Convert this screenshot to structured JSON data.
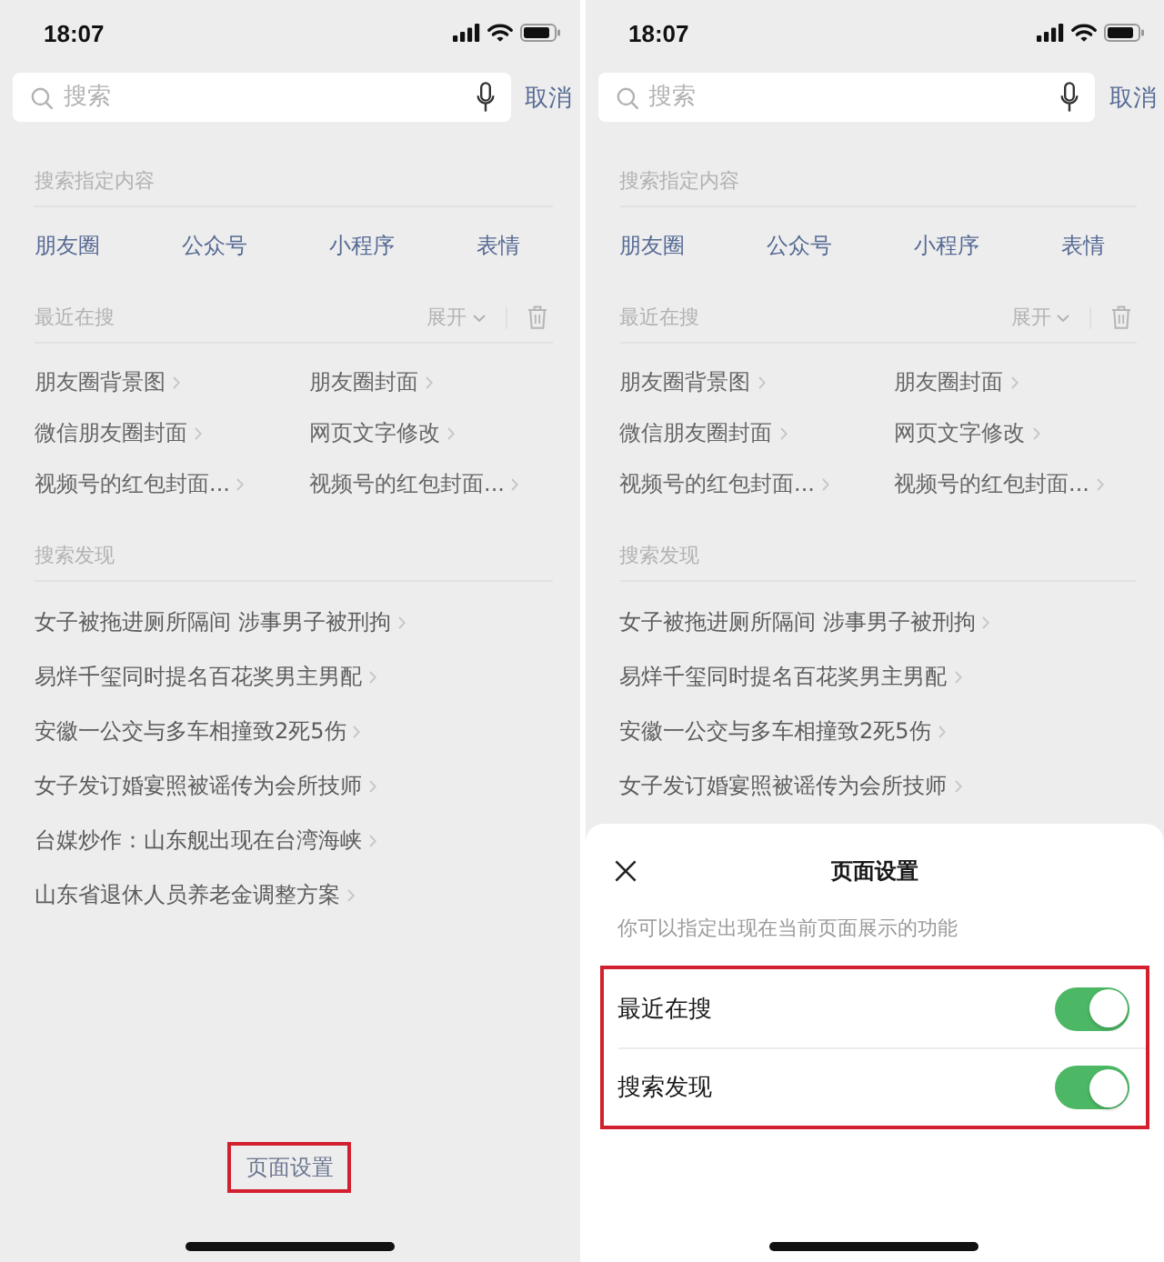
{
  "screens": [
    {
      "status_bar": {
        "time": "18:07"
      },
      "search": {
        "placeholder": "搜索",
        "cancel": "取消"
      },
      "specified_content": {
        "title": "搜索指定内容",
        "links": [
          "朋友圈",
          "公众号",
          "小程序",
          "表情"
        ]
      },
      "recent_searches": {
        "title": "最近在搜",
        "expand": "展开",
        "items": [
          "朋友圈背景图",
          "朋友圈封面",
          "微信朋友圈封面",
          "网页文字修改",
          "视频号的红包封面...",
          "视频号的红包封面..."
        ]
      },
      "discovery": {
        "title": "搜索发现",
        "items": [
          "女子被拖进厕所隔间 涉事男子被刑拘",
          "易烊千玺同时提名百花奖男主男配",
          "安徽一公交与多车相撞致2死5伤",
          "女子发订婚宴照被谣传为会所技师",
          "台媒炒作：山东舰出现在台湾海峡",
          "山东省退休人员养老金调整方案"
        ]
      },
      "footer_button": {
        "label": "页面设置",
        "highlighted": true
      }
    },
    {
      "status_bar": {
        "time": "18:07"
      },
      "search": {
        "placeholder": "搜索",
        "cancel": "取消"
      },
      "specified_content": {
        "title": "搜索指定内容",
        "links": [
          "朋友圈",
          "公众号",
          "小程序",
          "表情"
        ]
      },
      "recent_searches": {
        "title": "最近在搜",
        "expand": "展开",
        "items": [
          "朋友圈背景图",
          "朋友圈封面",
          "微信朋友圈封面",
          "网页文字修改",
          "视频号的红包封面...",
          "视频号的红包封面..."
        ]
      },
      "discovery": {
        "title": "搜索发现",
        "items": [
          "女子被拖进厕所隔间 涉事男子被刑拘",
          "易烊千玺同时提名百花奖男主男配",
          "安徽一公交与多车相撞致2死5伤",
          "女子发订婚宴照被谣传为会所技师"
        ]
      },
      "sheet": {
        "title": "页面设置",
        "description": "你可以指定出现在当前页面展示的功能",
        "highlighted": true,
        "options": [
          {
            "label": "最近在搜",
            "on": true
          },
          {
            "label": "搜索发现",
            "on": true
          }
        ]
      }
    }
  ]
}
